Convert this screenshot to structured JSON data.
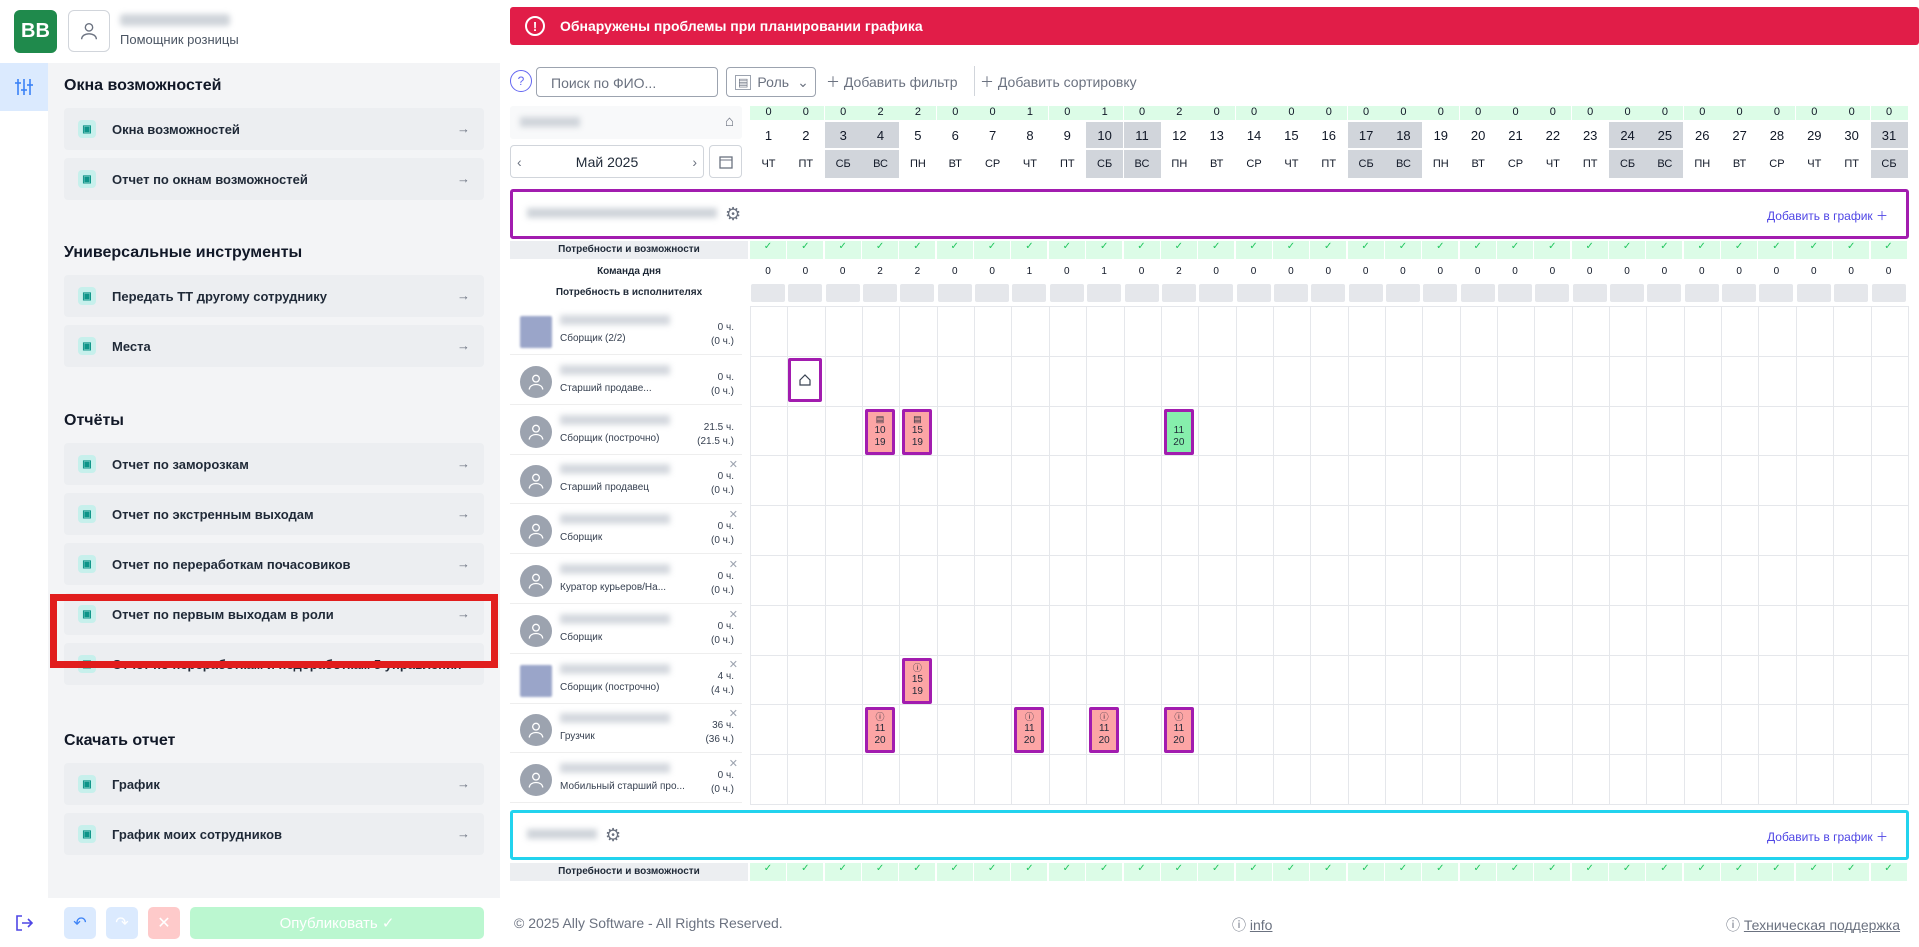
{
  "header": {
    "logo": "BB",
    "user_role": "Помощник розницы",
    "alert": "Обнаружены проблемы при планировании графика"
  },
  "sidebar": {
    "sections": [
      {
        "title": "Окна возможностей",
        "items": [
          "Окна возможностей",
          "Отчет по окнам возможностей"
        ]
      },
      {
        "title": "Универсальные инструменты",
        "items": [
          "Передать ТТ другому сотруднику",
          "Места"
        ]
      },
      {
        "title": "Отчёты",
        "items": [
          "Отчет по заморозкам",
          "Отчет по экстренным выходам",
          "Отчет по переработкам почасовиков",
          "Отчет по первым выходам в роли",
          "Отчет по переработкам и недоработкам 5 управления"
        ]
      },
      {
        "title": "Скачать отчет",
        "items": [
          "График",
          "График моих сотрудников"
        ]
      }
    ],
    "publish": "Опубликовать"
  },
  "toolbar": {
    "search_placeholder": "Поиск по ФИО...",
    "role": "Роль",
    "add_filter": "Добавить фильтр",
    "add_sort": "Добавить сортировку"
  },
  "calendar": {
    "month": "Май 2025",
    "days": [
      1,
      2,
      3,
      4,
      5,
      6,
      7,
      8,
      9,
      10,
      11,
      12,
      13,
      14,
      15,
      16,
      17,
      18,
      19,
      20,
      21,
      22,
      23,
      24,
      25,
      26,
      27,
      28,
      29,
      30,
      31
    ],
    "weekdays": [
      "ЧТ",
      "ПТ",
      "СБ",
      "ВС",
      "ПН",
      "ВТ",
      "СР",
      "ЧТ",
      "ПТ",
      "СБ",
      "ВС",
      "ПН",
      "ВТ",
      "СР",
      "ЧТ",
      "ПТ",
      "СБ",
      "ВС",
      "ПН",
      "ВТ",
      "СР",
      "ЧТ",
      "ПТ",
      "СБ",
      "ВС",
      "ПН",
      "ВТ",
      "СР",
      "ЧТ",
      "ПТ",
      "СБ"
    ],
    "counts": [
      0,
      0,
      0,
      2,
      2,
      0,
      0,
      1,
      0,
      1,
      0,
      2,
      0,
      0,
      0,
      0,
      0,
      0,
      0,
      0,
      0,
      0,
      0,
      0,
      0,
      0,
      0,
      0,
      0,
      0,
      0
    ],
    "weekend_idx": [
      2,
      3,
      9,
      10,
      16,
      17,
      23,
      24,
      30
    ]
  },
  "group": {
    "add_label": "Добавить в график",
    "rows": {
      "needs": "Потребности и возможности",
      "team": "Команда дня",
      "demand": "Потребность в исполнителях"
    }
  },
  "employees": [
    {
      "role": "Сборщик (2/2)",
      "h1": "0 ч.",
      "h2": "(0 ч.)",
      "photo": true
    },
    {
      "role": "Старший продаве...",
      "h1": "0 ч.",
      "h2": "(0 ч.)"
    },
    {
      "role": "Сборщик (построчно)",
      "h1": "21.5 ч.",
      "h2": "(21.5 ч.)"
    },
    {
      "role": "Старший продавец",
      "h1": "0 ч.",
      "h2": "(0 ч.)"
    },
    {
      "role": "Сборщик",
      "h1": "0 ч.",
      "h2": "(0 ч.)"
    },
    {
      "role": "Куратор курьеров/На...",
      "h1": "0 ч.",
      "h2": "(0 ч.)"
    },
    {
      "role": "Сборщик",
      "h1": "0 ч.",
      "h2": "(0 ч.)"
    },
    {
      "role": "Сборщик (построчно)",
      "h1": "4 ч.",
      "h2": "(4 ч.)",
      "photo": true
    },
    {
      "role": "Грузчик",
      "h1": "36 ч.",
      "h2": "(36 ч.)"
    },
    {
      "role": "Мобильный старший про...",
      "h1": "0 ч.",
      "h2": "(0 ч.)"
    }
  ],
  "shifts": [
    {
      "row": 2,
      "day": 4,
      "top": "10",
      "bottom": "19",
      "color": "#fca5a5",
      "icon": "doc"
    },
    {
      "row": 2,
      "day": 5,
      "top": "15",
      "bottom": "19",
      "color": "#fca5a5",
      "icon": "doc"
    },
    {
      "row": 2,
      "day": 12,
      "top": "11",
      "bottom": "20",
      "color": "#86efac",
      "icon": ""
    },
    {
      "row": 7,
      "day": 5,
      "top": "15",
      "bottom": "19",
      "color": "#fca5a5",
      "icon": "warn"
    },
    {
      "row": 8,
      "day": 4,
      "top": "11",
      "bottom": "20",
      "color": "#fca5a5",
      "icon": "warn"
    },
    {
      "row": 8,
      "day": 8,
      "top": "11",
      "bottom": "20",
      "color": "#fca5a5",
      "icon": "warn"
    },
    {
      "row": 8,
      "day": 10,
      "top": "11",
      "bottom": "20",
      "color": "#fca5a5",
      "icon": "warn"
    },
    {
      "row": 8,
      "day": 12,
      "top": "11",
      "bottom": "20",
      "color": "#fca5a5",
      "icon": "warn"
    }
  ],
  "footer": {
    "copyright": "© 2025 Ally Software - All Rights Reserved.",
    "info": "info",
    "support": "Техническая поддержка"
  },
  "colors": {
    "accent": "#a21caf",
    "group2": "#22d3ee",
    "alert": "#e11d48",
    "check": "#22c55e"
  }
}
